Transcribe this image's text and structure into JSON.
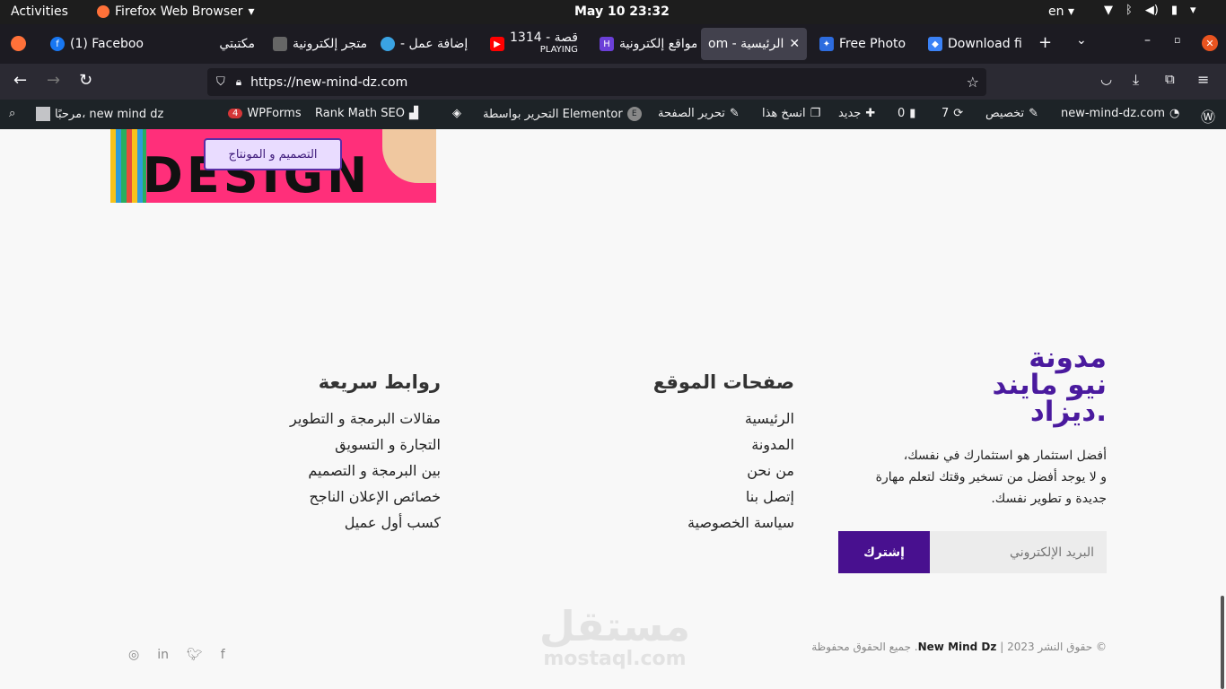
{
  "os": {
    "activities": "Activities",
    "app_name": "Firefox Web Browser",
    "clock": "May 10  23:32",
    "lang": "en"
  },
  "tabs": [
    {
      "label": "(1) Faceboo",
      "icon_color": "#1877f2",
      "icon": "f"
    },
    {
      "label": "مكتبتي",
      "icon_color": "#42414d",
      "icon": ""
    },
    {
      "label": "متجر إلكترونية",
      "icon_color": "#777777",
      "icon": ""
    },
    {
      "label": "إضافة عمل - ",
      "icon_color": "#3aa3e3",
      "icon": ""
    },
    {
      "label": "1314 - قصة",
      "sub": "PLAYING",
      "icon_color": "#ff0000",
      "icon": "▶"
    },
    {
      "label": "مواقع إلكترونية",
      "icon_color": "#6b3fd8",
      "icon": "H"
    },
    {
      "label": "الرئيسية - om",
      "icon_color": "",
      "icon": ""
    },
    {
      "label": "Free Photo",
      "icon_color": "#2d6cdf",
      "icon": "✦"
    },
    {
      "label": "Download fi",
      "icon_color": "#3b82f6",
      "icon": "◆"
    }
  ],
  "url": "https://new-mind-dz.com",
  "wp": {
    "site": "new-mind-dz.com",
    "customize": "تخصيص",
    "updates": "7",
    "comments": "0",
    "new": "جديد",
    "copy": "انسخ هذا",
    "edit_page": "تحرير الصفحة",
    "elementor": "التحرير بواسطة Elementor",
    "rankmath": "Rank Math SEO",
    "wpforms": "WPForms",
    "wpforms_badge": "4",
    "greeting": "مرحبًا، new mind dz"
  },
  "hero": {
    "letters": "DESIGN",
    "tag": "التصميم و المونتاج"
  },
  "footer": {
    "brand_lines": [
      "مدونة",
      "نيو مايند",
      "ديزاد."
    ],
    "desc_lines": [
      "أفضل استثمار هو استثمارك في نفسك،",
      "و لا يوجد أفضل من تسخير وقتك لتعلم مهارة",
      "جديدة و تطوير نفسك."
    ],
    "subscribe_label": "إشترك",
    "email_placeholder": "البريد الإلكتروني",
    "pages_title": "صفحات الموقع",
    "pages": [
      "الرئيسية",
      "المدونة",
      "من نحن",
      "إتصل بنا",
      "سياسة الخصوصية"
    ],
    "links_title": "روابط سريعة",
    "links": [
      "مقالات البرمجة و التطوير",
      "التجارة و التسويق",
      "بين البرمجة و التصميم",
      "خصائص الإعلان الناجح",
      "كسب أول عميل"
    ],
    "copyright_prefix": "© حقوق النشر 2023 | ",
    "copyright_brand": "New Mind Dz",
    "copyright_suffix": ". جميع الحقوق محفوظة"
  },
  "watermark": {
    "ar": "مستقل",
    "en": "mostaql.com"
  },
  "brand_color": "#48108f"
}
